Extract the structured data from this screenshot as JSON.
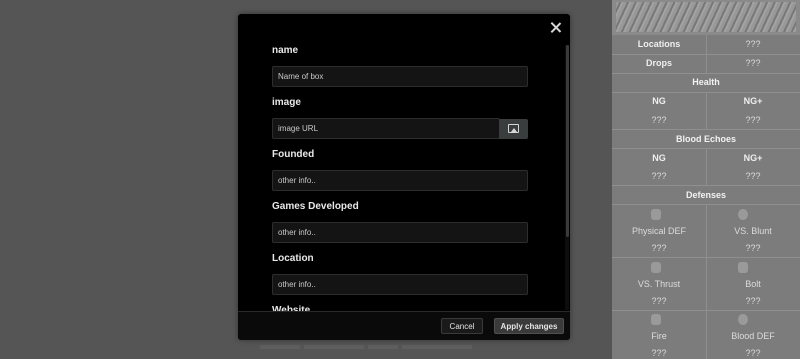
{
  "infobox": {
    "locations_label": "Locations",
    "locations_value": "???",
    "drops_label": "Drops",
    "drops_value": "???",
    "health_heading": "Health",
    "health_ng_label": "NG",
    "health_ngplus_label": "NG+",
    "health_ng_value": "???",
    "health_ngplus_value": "???",
    "echoes_heading": "Blood Echoes",
    "echoes_ng_label": "NG",
    "echoes_ngplus_label": "NG+",
    "echoes_ng_value": "???",
    "echoes_ngplus_value": "???",
    "defenses_heading": "Defenses",
    "defenses": [
      {
        "label": "Physical DEF",
        "value": "???",
        "icon": "shield-icon"
      },
      {
        "label": "VS. Blunt",
        "value": "???",
        "icon": "blunt-icon"
      },
      {
        "label": "VS. Thrust",
        "value": "???",
        "icon": "thrust-icon"
      },
      {
        "label": "Bolt",
        "value": "???",
        "icon": "bolt-icon"
      },
      {
        "label": "Fire",
        "value": "???",
        "icon": "fire-icon"
      },
      {
        "label": "Blood DEF",
        "value": "???",
        "icon": "blood-icon"
      }
    ]
  },
  "modal": {
    "fields": [
      {
        "label": "name",
        "placeholder": "Name of box"
      },
      {
        "label": "image",
        "placeholder": "image URL"
      },
      {
        "label": "Founded",
        "placeholder": "other info.."
      },
      {
        "label": "Games Developed",
        "placeholder": "other info.."
      },
      {
        "label": "Location",
        "placeholder": "other info.."
      },
      {
        "label": "Website",
        "placeholder": ""
      }
    ],
    "cancel_label": "Cancel",
    "apply_label": "Apply changes"
  },
  "colors": {
    "modal_bg": "#000000",
    "overlay": "#555555",
    "apply_bg": "#3a3a3a"
  }
}
